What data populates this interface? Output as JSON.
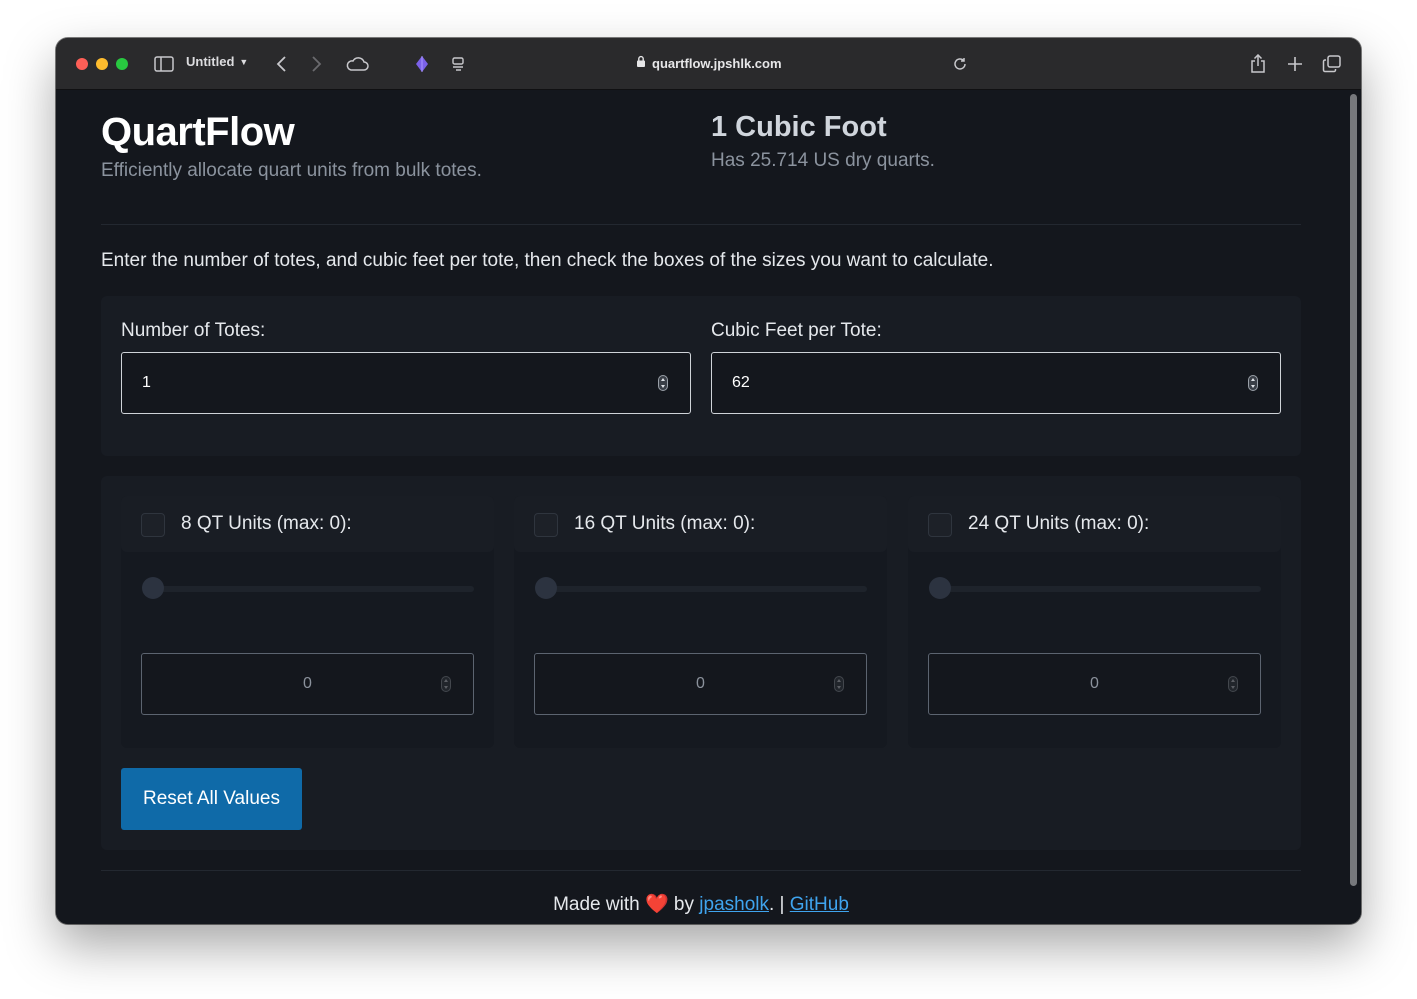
{
  "browser": {
    "tab_title": "Untitled",
    "url": "quartflow.jpshlk.com"
  },
  "header": {
    "title": "QuartFlow",
    "tagline": "Efficiently allocate quart units from bulk totes.",
    "conversion_title": "1 Cubic Foot",
    "conversion_text": "Has 25.714 US dry quarts."
  },
  "instructions": "Enter the number of totes, and cubic feet per tote, then check the boxes of the sizes you want to calculate.",
  "inputs": {
    "totes_label": "Number of Totes:",
    "totes_value": "1",
    "cubic_label": "Cubic Feet per Tote:",
    "cubic_value": "62"
  },
  "units": [
    {
      "label": "8 QT Units (max: 0):",
      "checked": false,
      "slider_value": 0,
      "value": "0"
    },
    {
      "label": "16 QT Units (max: 0):",
      "checked": false,
      "slider_value": 0,
      "value": "0"
    },
    {
      "label": "24 QT Units (max: 0):",
      "checked": false,
      "slider_value": 0,
      "value": "0"
    }
  ],
  "reset_label": "Reset All Values",
  "footer": {
    "made_with": "Made with",
    "heart": "❤️",
    "by": "by",
    "author": "jpasholk",
    "separator": ". |",
    "github": "GitHub"
  },
  "colors": {
    "background": "#14171d",
    "accent": "#0f6aa8",
    "link": "#3fa4ee"
  }
}
